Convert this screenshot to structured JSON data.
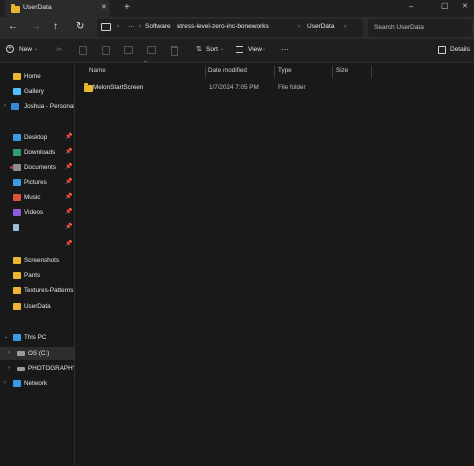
{
  "window": {
    "tab_title": "UserData",
    "new_tab_label": "+",
    "controls": [
      "–",
      "▢",
      "✕"
    ]
  },
  "address": {
    "more": "···",
    "crumbs": [
      "Software",
      "stress-level-zero-inc-boneworks",
      "UserData"
    ],
    "search_placeholder": "Search UserData"
  },
  "toolbar": {
    "new_label": "New",
    "sort_label": "Sort",
    "view_label": "View",
    "more_label": "···",
    "details_label": "Details"
  },
  "sidebar": {
    "home": "Home",
    "gallery": "Gallery",
    "onedrive": "Joshua - Personal",
    "quick": [
      {
        "label": "Desktop"
      },
      {
        "label": "Downloads"
      },
      {
        "label": "Documents"
      },
      {
        "label": "Pictures"
      },
      {
        "label": "Music"
      },
      {
        "label": "Videos"
      },
      {
        "label": ""
      },
      {
        "label": ""
      },
      {
        "label": "Screenshots"
      },
      {
        "label": "Pants"
      },
      {
        "label": "Textures-Patterns"
      },
      {
        "label": "UserData"
      }
    ],
    "this_pc": "This PC",
    "os_drive": "OS (C:)",
    "photo_drive": "PHOTOGRAPHY (I",
    "network": "Network"
  },
  "columns": {
    "name": "Name",
    "date": "Date modified",
    "type": "Type",
    "size": "Size"
  },
  "files": [
    {
      "name": "MelonStartScreen",
      "date": "1/7/2024 7:05 PM",
      "type": "File folder",
      "size": ""
    }
  ],
  "colors": {
    "folder": "#e8b62f",
    "accent": "#4cc2ff",
    "background": "#191919"
  }
}
